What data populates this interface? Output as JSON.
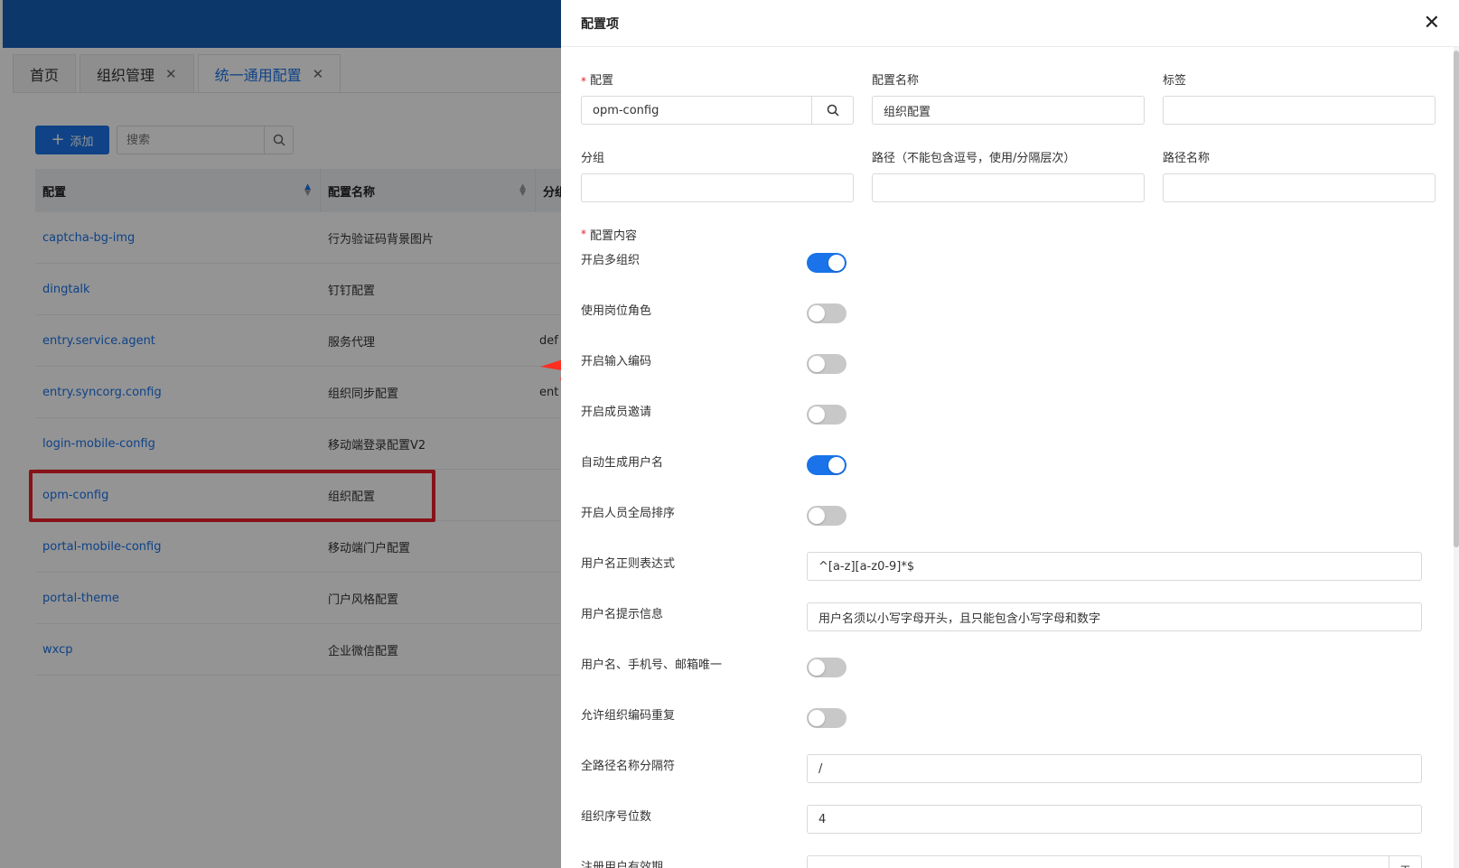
{
  "tabs": [
    {
      "label": "首页",
      "closable": false,
      "active": false
    },
    {
      "label": "组织管理",
      "closable": true,
      "active": false
    },
    {
      "label": "统一通用配置",
      "closable": true,
      "active": true
    }
  ],
  "toolbar": {
    "add_label": "添加",
    "search_placeholder": "搜索"
  },
  "table": {
    "headers": [
      "配置",
      "配置名称",
      "分组"
    ],
    "rows": [
      {
        "key": "captcha-bg-img",
        "name": "行为验证码背景图片",
        "group": ""
      },
      {
        "key": "dingtalk",
        "name": "钉钉配置",
        "group": ""
      },
      {
        "key": "entry.service.agent",
        "name": "服务代理",
        "group": "def"
      },
      {
        "key": "entry.syncorg.config",
        "name": "组织同步配置",
        "group": "ent"
      },
      {
        "key": "login-mobile-config",
        "name": "移动端登录配置V2",
        "group": ""
      },
      {
        "key": "opm-config",
        "name": "组织配置",
        "group": ""
      },
      {
        "key": "portal-mobile-config",
        "name": "移动端门户配置",
        "group": ""
      },
      {
        "key": "portal-theme",
        "name": "门户风格配置",
        "group": ""
      },
      {
        "key": "wxcp",
        "name": "企业微信配置",
        "group": ""
      }
    ]
  },
  "drawer": {
    "title": "配置项",
    "fields": {
      "config_label": "配置",
      "config_value": "opm-config",
      "config_name_label": "配置名称",
      "config_name_value": "组织配置",
      "tag_label": "标签",
      "tag_value": "",
      "group_label": "分组",
      "group_value": "",
      "path_label": "路径（不能包含逗号，使用/分隔层次）",
      "path_value": "",
      "path_name_label": "路径名称",
      "path_name_value": ""
    },
    "content_label": "配置内容",
    "content_rows": [
      {
        "label": "开启多组织",
        "type": "toggle",
        "on": true
      },
      {
        "label": "使用岗位角色",
        "type": "toggle",
        "on": false
      },
      {
        "label": "开启输入编码",
        "type": "toggle",
        "on": false
      },
      {
        "label": "开启成员邀请",
        "type": "toggle",
        "on": false
      },
      {
        "label": "自动生成用户名",
        "type": "toggle",
        "on": true
      },
      {
        "label": "开启人员全局排序",
        "type": "toggle",
        "on": false
      },
      {
        "label": "用户名正则表达式",
        "type": "input",
        "value": "^[a-z][a-z0-9]*$"
      },
      {
        "label": "用户名提示信息",
        "type": "input",
        "value": "用户名须以小写字母开头，且只能包含小写字母和数字"
      },
      {
        "label": "用户名、手机号、邮箱唯一",
        "type": "toggle",
        "on": false
      },
      {
        "label": "允许组织编码重复",
        "type": "toggle",
        "on": false
      },
      {
        "label": "全路径名称分隔符",
        "type": "input",
        "value": "/"
      },
      {
        "label": "组织序号位数",
        "type": "input",
        "value": "4"
      },
      {
        "label": "注册用户有效期",
        "type": "stepper",
        "value": "",
        "unit": "天"
      }
    ]
  },
  "colors": {
    "primary": "#1a73e8",
    "topbar": "#1560b8",
    "highlight": "#e8202a"
  }
}
